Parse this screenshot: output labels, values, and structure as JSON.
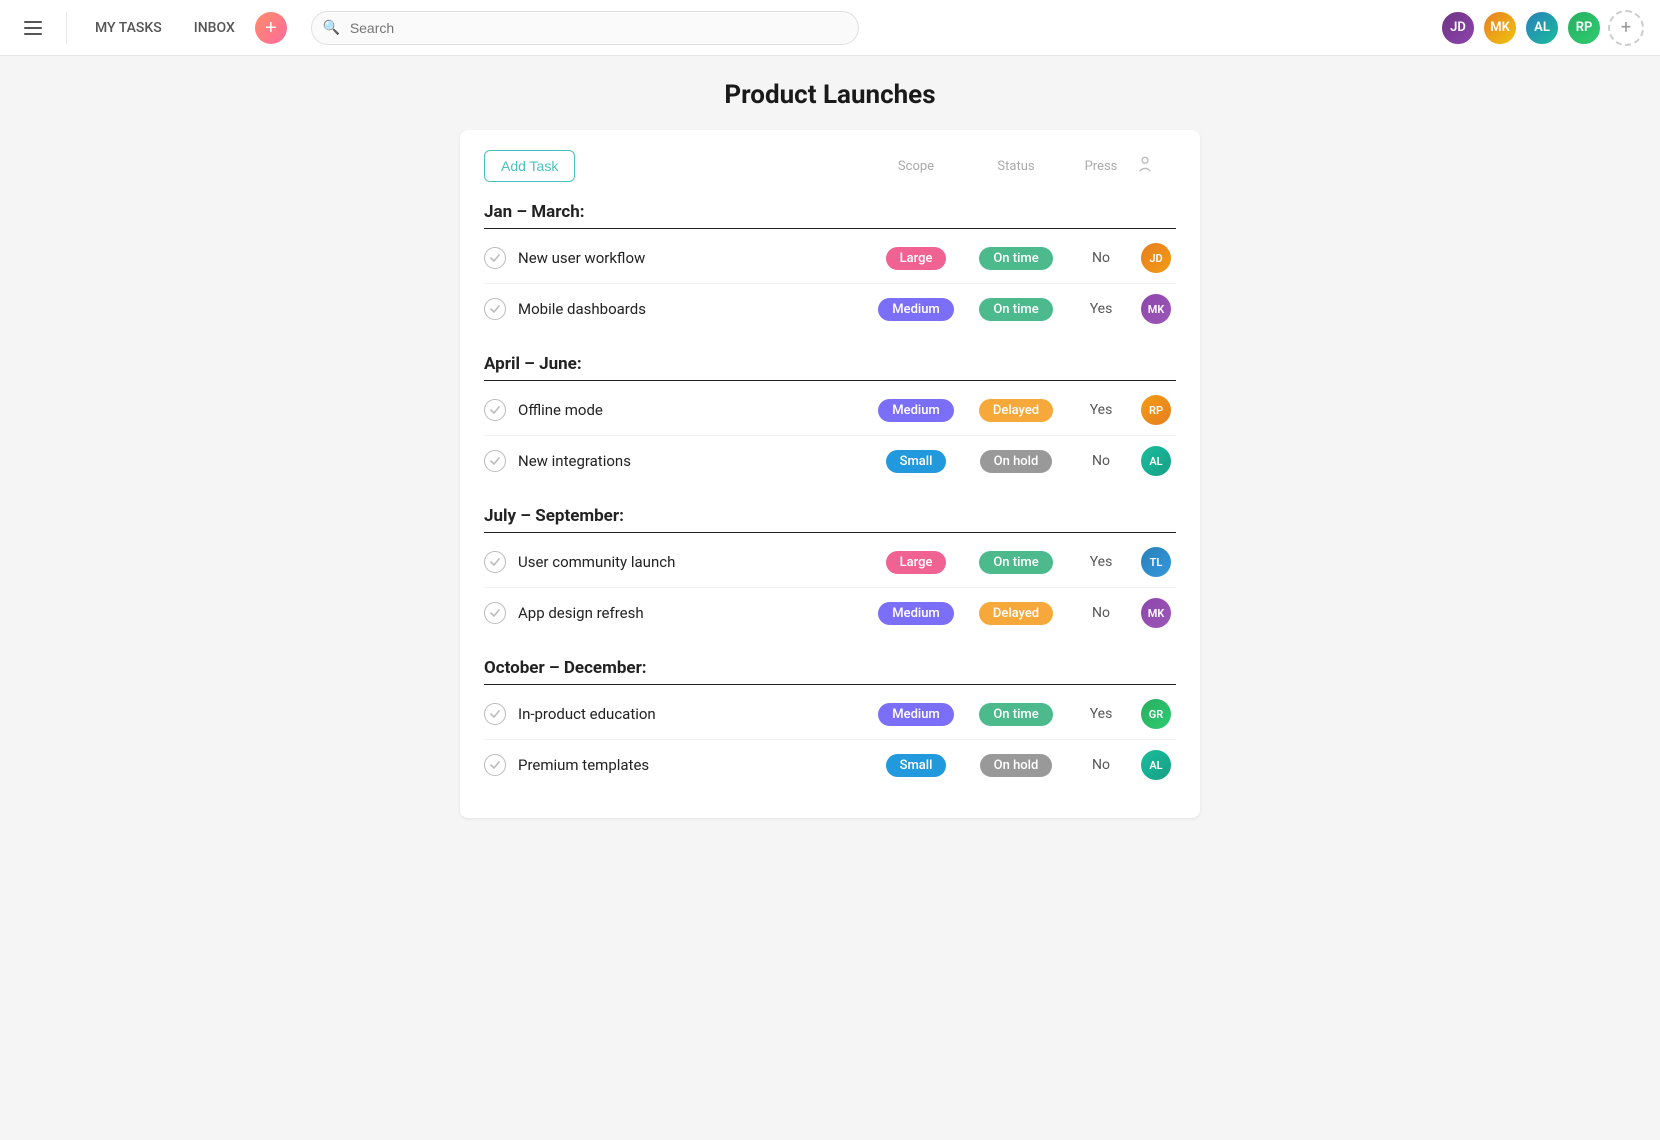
{
  "nav": {
    "my_tasks": "MY TASKS",
    "inbox": "INBOX",
    "search_placeholder": "Search",
    "page_title": "Product Launches",
    "avatars": [
      {
        "initials": "JD",
        "class": "nav-av1"
      },
      {
        "initials": "MK",
        "class": "nav-av2"
      },
      {
        "initials": "AL",
        "class": "nav-av3"
      },
      {
        "initials": "RP",
        "class": "nav-av4"
      }
    ]
  },
  "toolbar": {
    "add_task_label": "Add Task",
    "col_scope": "Scope",
    "col_status": "Status",
    "col_press": "Press"
  },
  "sections": [
    {
      "title": "Jan – March:",
      "tasks": [
        {
          "name": "New user workflow",
          "scope": "Large",
          "scope_class": "badge-large",
          "status": "On time",
          "status_class": "badge-on-time",
          "press": "No",
          "avatar_class": "av1",
          "avatar_initials": "JD"
        },
        {
          "name": "Mobile dashboards",
          "scope": "Medium",
          "scope_class": "badge-medium",
          "status": "On time",
          "status_class": "badge-on-time",
          "press": "Yes",
          "avatar_class": "av2",
          "avatar_initials": "MK"
        }
      ]
    },
    {
      "title": "April – June:",
      "tasks": [
        {
          "name": "Offline mode",
          "scope": "Medium",
          "scope_class": "badge-medium",
          "status": "Delayed",
          "status_class": "badge-delayed",
          "press": "Yes",
          "avatar_class": "av4",
          "avatar_initials": "RP"
        },
        {
          "name": "New integrations",
          "scope": "Small",
          "scope_class": "badge-small",
          "status": "On hold",
          "status_class": "badge-on-hold",
          "press": "No",
          "avatar_class": "av5",
          "avatar_initials": "AL"
        }
      ]
    },
    {
      "title": "July – September:",
      "tasks": [
        {
          "name": "User community launch",
          "scope": "Large",
          "scope_class": "badge-large",
          "status": "On time",
          "status_class": "badge-on-time",
          "press": "Yes",
          "avatar_class": "av6",
          "avatar_initials": "TL"
        },
        {
          "name": "App design refresh",
          "scope": "Medium",
          "scope_class": "badge-medium",
          "status": "Delayed",
          "status_class": "badge-delayed",
          "press": "No",
          "avatar_class": "av2",
          "avatar_initials": "MK"
        }
      ]
    },
    {
      "title": "October – December:",
      "tasks": [
        {
          "name": "In-product education",
          "scope": "Medium",
          "scope_class": "badge-medium",
          "status": "On time",
          "status_class": "badge-on-time",
          "press": "Yes",
          "avatar_class": "av7",
          "avatar_initials": "GR"
        },
        {
          "name": "Premium templates",
          "scope": "Small",
          "scope_class": "badge-small",
          "status": "On hold",
          "status_class": "badge-on-hold",
          "press": "No",
          "avatar_class": "av5",
          "avatar_initials": "AL"
        }
      ]
    }
  ]
}
